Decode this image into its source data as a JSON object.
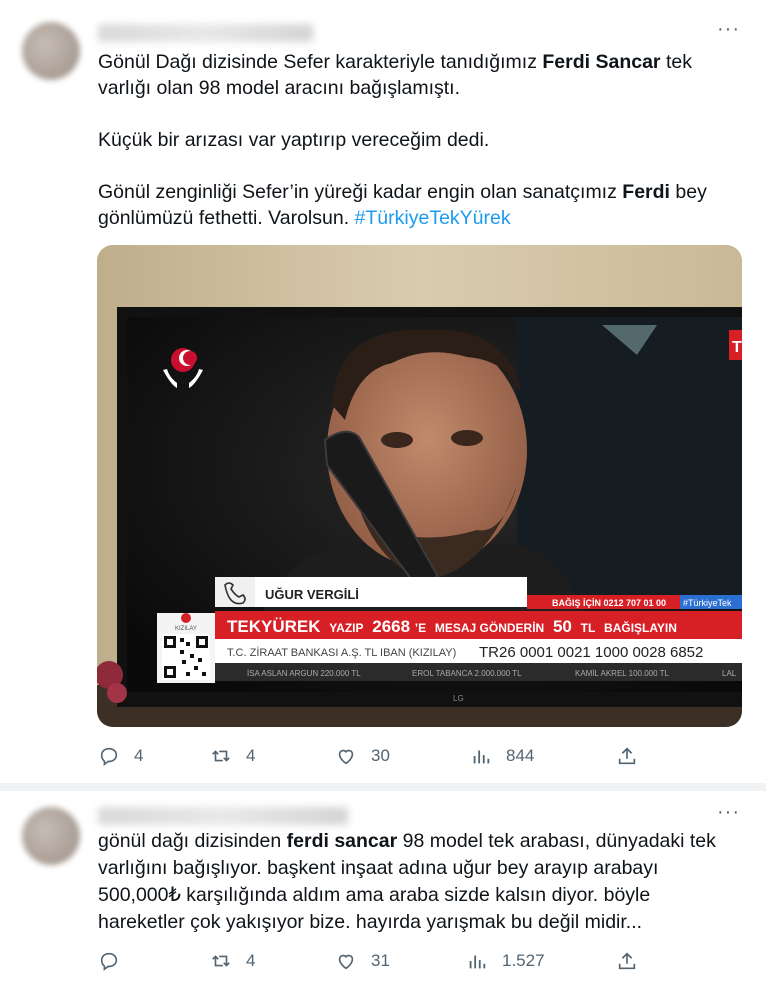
{
  "tweet1": {
    "more": "···",
    "para1_prefix": "Gönül Dağı dizisinde Sefer karakteriyle tanıdığımız ",
    "para1_bold": "Ferdi Sancar",
    "para1_suffix": " tek varlığı olan 98 model aracını bağışlamıştı.",
    "para2": "Küçük bir arızası var yaptırıp vereceğim dedi.",
    "para3_prefix": "Gönül zenginliği Sefer’in yüreği kadar engin olan sanatçımız ",
    "para3_bold": "Ferdi",
    "para3_mid": " bey gönlümüzü fethetti. Varolsun. ",
    "hashtag": "#TürkiyeTekYürek",
    "media": {
      "caller_name": "UĞUR VERGİLİ",
      "phone_label": "BAĞIŞ İÇİN 0212 707 01 00",
      "tv_hashtag": "#TürkiyeTek",
      "ticker_main": "TEKYÜREK",
      "ticker_yazip": "YAZIP",
      "ticker_code": "2668",
      "ticker_e": "’E",
      "ticker_mesaj": "MESAJ GÖNDERİN",
      "ticker_amount": "50",
      "ticker_tl": "TL",
      "ticker_bagis": "BAĞIŞLAYIN",
      "bank_label": "T.C. ZİRAAT BANKASI A.Ş. TL IBAN (KIZILAY)",
      "iban": "TR26 0001 0021 1000 0028 6852",
      "donor1": "İSA ASLAN ARGUN  220.000 TL",
      "donor2": "EROL TABANCA  2.000.000 TL",
      "donor3": "KAMİL AKREL  100.000 TL",
      "donor4": "LAL",
      "tv_brand": "LG",
      "kizilay_label": "KIZILAY",
      "red_tab": "T"
    },
    "replies": "4",
    "retweets": "",
    "likes": "30",
    "views": "844"
  },
  "tweet2": {
    "more": "···",
    "text_prefix": "gönül dağı dizisinden ",
    "text_bold": "ferdi sancar",
    "text_suffix": " 98 model tek arabası, dünyadaki tek varlığını bağışlıyor. başkent inşaat adına uğur bey arayıp arabayı 500,000₺ karşılığında aldım ama araba sizde kalsın diyor. böyle hareketler çok yakışıyor bize. hayırda yarışmak bu değil midir...",
    "replies": "",
    "retweets": "4",
    "likes": "31",
    "views": "1.527"
  },
  "icons": {
    "reply": "reply-icon",
    "retweet": "retweet-icon",
    "like": "like-icon",
    "views": "views-icon",
    "share": "share-icon"
  },
  "colors": {
    "hashtag": "#1d9bf0",
    "action_gray": "#536471",
    "ticker_red": "#d71f26"
  }
}
